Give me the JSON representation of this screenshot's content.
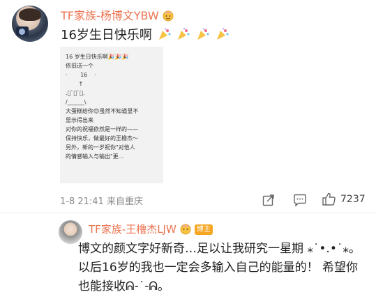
{
  "main_comment": {
    "username": "TF家族-杨博文YBW",
    "text": "16岁生日快乐啊",
    "meta": "1-8 21:41 来自重庆",
    "like_count": "7237"
  },
  "embedded_image": {
    "lines": [
      "16 岁生日快乐啊🎉🎉🎉",
      "依旧送一个",
      "·　　 16　 ·",
      "　　 ↑",
      " .ﾞ`ﾞ`ﾞ.",
      "/______\\",
      "大蛋糕给你😊虽然不知道显不",
      "显示得出来",
      "对你的祝福依然是一样的——",
      "保持快乐，做最好的王橹杰～",
      "另外，新的一岁祝你\"对他人",
      "的情感输入与输出\"更..."
    ]
  },
  "reply": {
    "username": "TF家族-王橹杰LJW",
    "author_tag": "博主",
    "text": "博文的颜文字好新奇…足以让我研究一星期 ⁎˙•.•˙⁎。 以后16岁的我也一定会多输入自己的能量的！ 希望你也能接收ᕱ-˙-ᕱ。"
  },
  "colors": {
    "username": "#eb7350",
    "meta": "#8a8a8a",
    "tag_bg": "#f5a623"
  },
  "icons": [
    "share-icon",
    "comment-icon",
    "like-icon",
    "emoji-party-icon",
    "ribbon-badge-icon"
  ]
}
